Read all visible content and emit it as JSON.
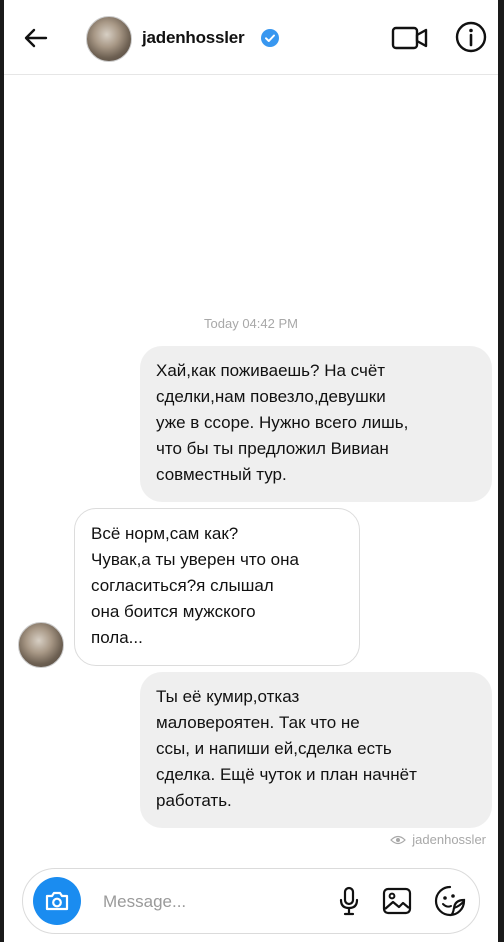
{
  "header": {
    "username": "jadenhossler",
    "icons": {
      "back": "back-arrow-icon",
      "verified": "verified-badge-icon",
      "video": "video-camera-icon",
      "info": "info-icon"
    },
    "accent_color": "#1a8cf0"
  },
  "thread": {
    "timestamp": "Today 04:42 PM",
    "messages": [
      {
        "direction": "outgoing",
        "text": "Хай,как поживаешь? На счёт\nсделки,нам повезло,девушки\nуже в ссоре. Нужно всего лишь,\nчто бы ты предложил Вивиан\nсовместный тур."
      },
      {
        "direction": "incoming",
        "text": "Всё норм,сам как?\nЧувак,а ты уверен что она\nсогласиться?я слышал\nона боится мужского\nпола..."
      },
      {
        "direction": "outgoing",
        "text": "Ты её кумир,отказ\nмаловероятен. Так что  не\nссы, и напиши ей,сделка есть\nсделка. Ещё чуток и план начнёт\nработать."
      }
    ],
    "seen_by": "jadenhossler"
  },
  "composer": {
    "placeholder": "Message...",
    "value": "",
    "icons": {
      "camera": "camera-icon",
      "mic": "microphone-icon",
      "gallery": "gallery-icon",
      "sticker": "sticker-icon"
    }
  }
}
